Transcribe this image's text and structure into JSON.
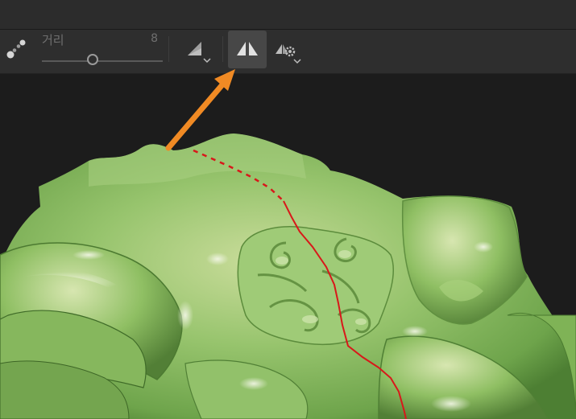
{
  "toolbar": {
    "distance_slider": {
      "label": "거리",
      "value": "8",
      "level_percent": 42
    },
    "icons": {
      "brush": "brush-stroke-icon",
      "falloff": "falloff-triangle-icon",
      "symmetry": "mirror-symmetry-icon",
      "symmetry_settings": "symmetry-settings-gear-icon",
      "dropdown": "chevron-down-icon"
    },
    "symmetry_active": true
  },
  "annotation": {
    "arrow_color": "#f08a24",
    "target": "mirror-symmetry-button"
  },
  "viewport": {
    "model_color": "#8fc46a",
    "symmetry_line_color": "#d8181a",
    "background": "#1c1c1c"
  }
}
